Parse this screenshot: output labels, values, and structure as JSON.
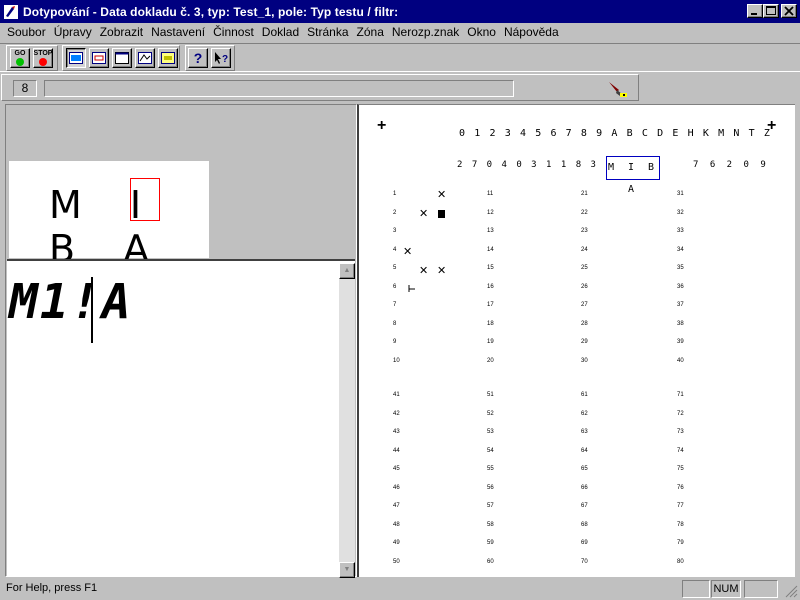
{
  "window": {
    "title": "Dotypování - Data dokladu č. 3,  typ: Test_1,  pole: Typ testu / filtr:",
    "min_label": "_",
    "max_label": "□",
    "close_label": "×"
  },
  "menu": [
    "Soubor",
    "Úpravy",
    "Zobrazit",
    "Nastavení",
    "Činnost",
    "Doklad",
    "Stránka",
    "Zóna",
    "Nerozp.znak",
    "Okno",
    "Nápověda"
  ],
  "toolbar": {
    "go_label": "GO",
    "stop_label": "STOP",
    "help_label": "?",
    "context_help_label": "?",
    "colors": {
      "go": "#00c000",
      "stop": "#ff0000"
    }
  },
  "fieldbar": {
    "count": "8",
    "progress": 0
  },
  "left": {
    "snippet_text": "M I B A",
    "recognized_text": "M1!A"
  },
  "document": {
    "charset": "0 1 2 3 4 5 6 7 8 9 A B C D E H K M N T Z",
    "handwritten_id": "2 7 0 4 0 3 1 1 8 3",
    "id_box": "M I B A",
    "handwritten_code": "7 6 2 0 9",
    "columns_top": [
      [
        "1",
        "2",
        "3",
        "4",
        "5",
        "6",
        "7",
        "8",
        "9",
        "10"
      ],
      [
        "11",
        "12",
        "13",
        "14",
        "15",
        "16",
        "17",
        "18",
        "19",
        "20"
      ],
      [
        "21",
        "22",
        "23",
        "24",
        "25",
        "26",
        "27",
        "28",
        "29",
        "30"
      ],
      [
        "31",
        "32",
        "33",
        "34",
        "35",
        "36",
        "37",
        "38",
        "39",
        "40"
      ]
    ],
    "columns_bottom": [
      [
        "41",
        "42",
        "43",
        "44",
        "45",
        "46",
        "47",
        "48",
        "49",
        "50"
      ],
      [
        "51",
        "52",
        "53",
        "54",
        "55",
        "56",
        "57",
        "58",
        "59",
        "60"
      ],
      [
        "61",
        "62",
        "63",
        "64",
        "65",
        "66",
        "67",
        "68",
        "69",
        "70"
      ],
      [
        "71",
        "72",
        "73",
        "74",
        "75",
        "76",
        "77",
        "78",
        "79",
        "80"
      ]
    ],
    "cross_mark": "✕",
    "reg_mark": "+"
  },
  "status": {
    "help_text": "For Help, press F1",
    "num": "NUM"
  }
}
